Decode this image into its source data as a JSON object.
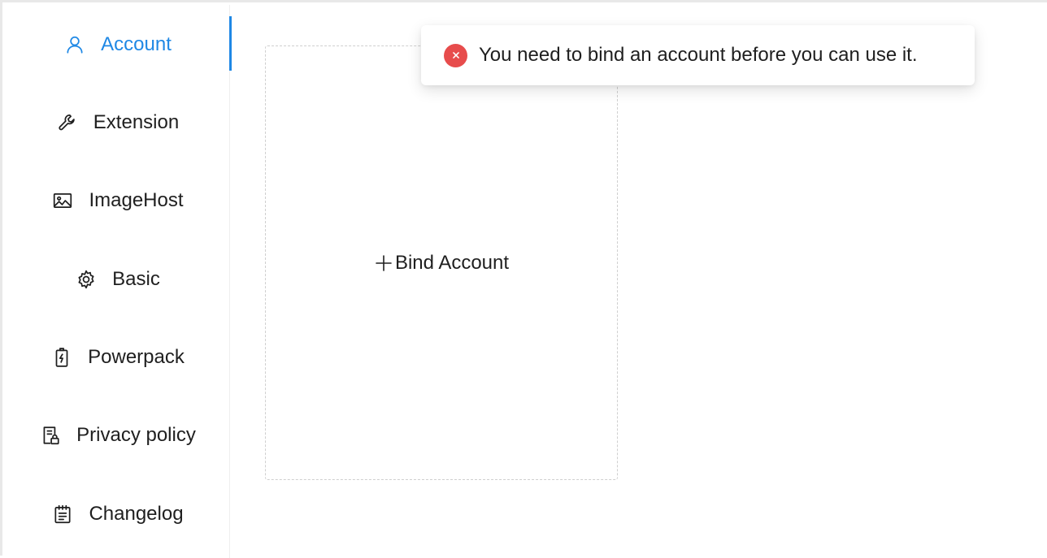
{
  "sidebar": {
    "items": [
      {
        "label": "Account",
        "icon": "user-icon",
        "active": true
      },
      {
        "label": "Extension",
        "icon": "wrench-icon",
        "active": false
      },
      {
        "label": "ImageHost",
        "icon": "image-icon",
        "active": false
      },
      {
        "label": "Basic",
        "icon": "gear-icon",
        "active": false
      },
      {
        "label": "Powerpack",
        "icon": "battery-bolt-icon",
        "active": false
      },
      {
        "label": "Privacy policy",
        "icon": "document-lock-icon",
        "active": false
      },
      {
        "label": "Changelog",
        "icon": "notepad-icon",
        "active": false
      }
    ],
    "active_color": "#1f88e5"
  },
  "main": {
    "bind_card": {
      "label": "Bind Account",
      "icon": "plus-icon"
    }
  },
  "toast": {
    "type": "error",
    "icon": "error-icon",
    "message": "You need to bind an account before you can use it.",
    "icon_color": "#e74c4c"
  }
}
